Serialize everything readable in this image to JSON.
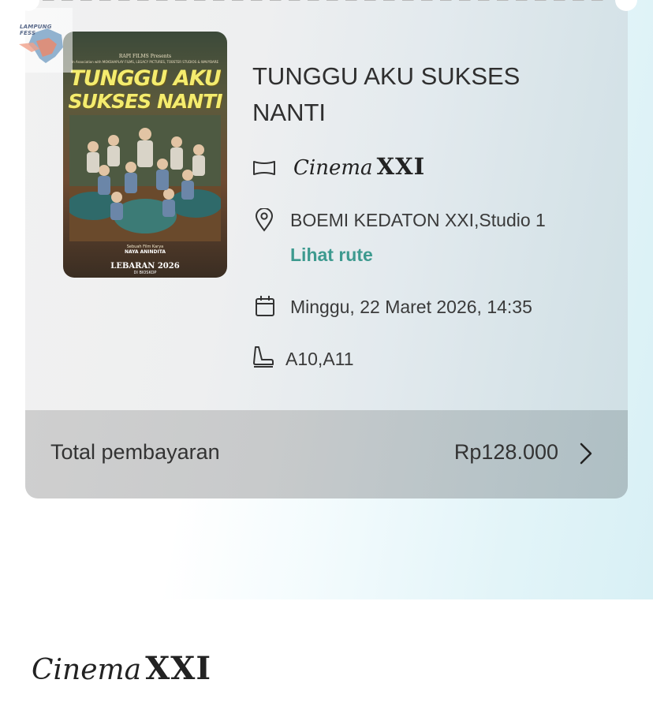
{
  "watermark": {
    "text_line1": "LAMPUNG",
    "text_line2": "FESS"
  },
  "poster": {
    "publisher": "RAPI FILMS Presents",
    "credit": "In Association with MOKSHAPLAY FILMS, LEGACY PICTURES, TOBSTER STUDIOS & WAVYBARE",
    "title_line1": "TUNGGU AKU",
    "title_line2": "SUKSES NANTI",
    "subtitle1": "Sebuah Film Karya",
    "director": "NAYA ANINDITA",
    "release": "LEBARAN 2026",
    "release_sub": "DI BIOSKOP"
  },
  "movie": {
    "title": "TUNGGU AKU SUKSES NANTI"
  },
  "cinema": {
    "script": "Cinema",
    "xxi": "XXI"
  },
  "location": {
    "name": "BOEMI KEDATON XXI,Studio 1",
    "route_link": "Lihat rute"
  },
  "schedule": {
    "datetime": "Minggu, 22 Maret 2026, 14:35"
  },
  "seats": {
    "value": "A10,A11"
  },
  "payment": {
    "label": "Total pembayaran",
    "amount": "Rp128.000"
  },
  "footer": {
    "brand_script": "Cinema",
    "brand_xxi": "XXI"
  },
  "colors": {
    "link": "#3d9a8f",
    "text": "#333333"
  }
}
